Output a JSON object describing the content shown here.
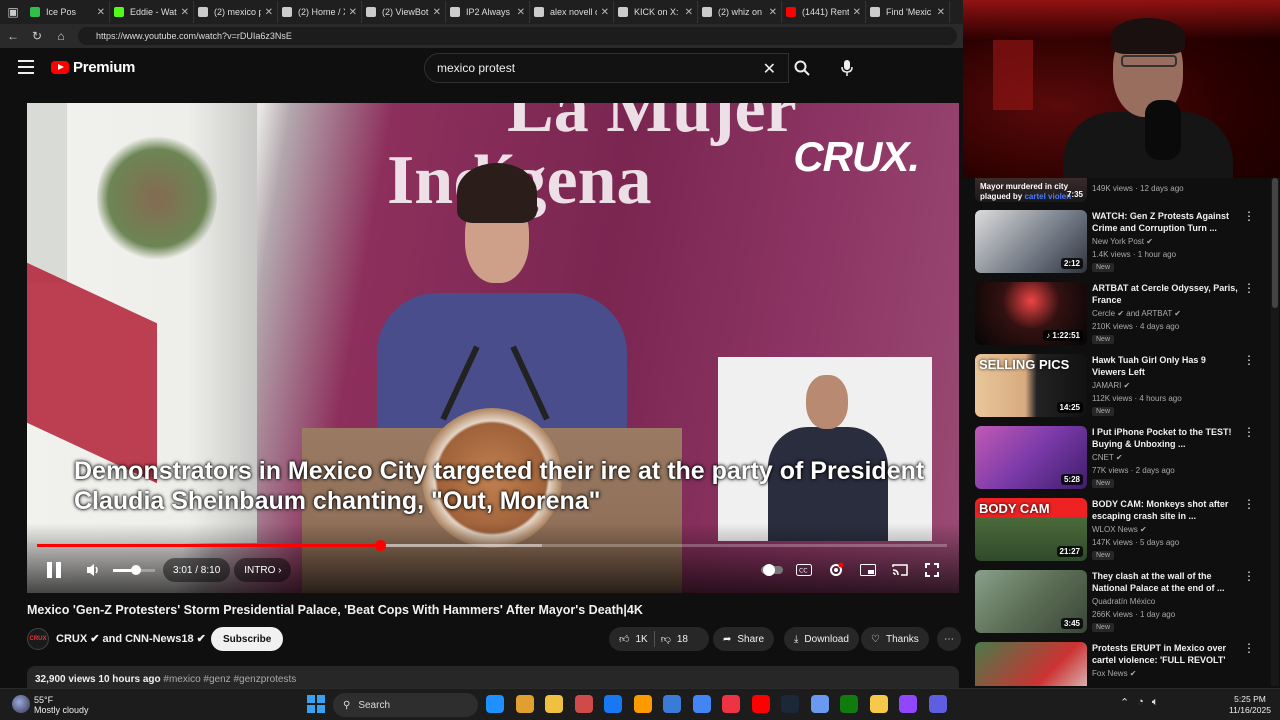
{
  "browser": {
    "tabs": [
      {
        "label": "Ice Pos",
        "color": "#2fbf4a"
      },
      {
        "label": "Eddie - Wat",
        "color": "#53fc18"
      },
      {
        "label": "(2) mexico p",
        "color": "#cccccc"
      },
      {
        "label": "(2) Home / X",
        "color": "#cccccc"
      },
      {
        "label": "(2) ViewBot",
        "color": "#cccccc"
      },
      {
        "label": "IP2 Always",
        "color": "#cccccc"
      },
      {
        "label": "alex novell c",
        "color": "#cccccc"
      },
      {
        "label": "KICK on X:",
        "color": "#cccccc"
      },
      {
        "label": "(2) whiz on",
        "color": "#cccccc"
      },
      {
        "label": "(1441) Rent",
        "color": "#ff0000"
      },
      {
        "label": "Find 'Mexic",
        "color": "#cccccc"
      }
    ],
    "url": "https://www.youtube.com/watch?v=rDUIa6z3NsE"
  },
  "header": {
    "brand": "Premium",
    "search_value": "mexico protest"
  },
  "player": {
    "bg_text_line1": "La Mujer",
    "bg_text_line2": "Indígena",
    "watermark": "CRUX.",
    "caption": "Demonstrators in Mexico City targeted their ire at the party of President Claudia Sheinbaum chanting, \"Out, Morena\"",
    "time": "3:01 / 8:10",
    "chapter": "INTRO",
    "progress_fraction": 0.377,
    "buffer_fraction": 0.555,
    "volume_fraction": 0.55
  },
  "video": {
    "title": "Mexico 'Gen-Z Protesters' Storm Presidential Palace, 'Beat Cops With Hammers' After Mayor's Death|4K",
    "channel": "CRUX ✔ and CNN-News18 ✔",
    "avatar_text": "CRUX",
    "subscribe": "Subscribe",
    "likes": "1K",
    "dislikes": "18",
    "share": "Share",
    "download": "Download",
    "thanks": "Thanks",
    "views_time": "32,900 views  10 hours ago",
    "tags": "#mexico #genz #genzprotests"
  },
  "sidebar": {
    "top_partial": {
      "title_a": "Mayor murdered in city",
      "title_b": "plagued by ",
      "title_hi": "cartel violen",
      "duration": "7:35",
      "stats": "149K views · 12 days ago"
    },
    "items": [
      {
        "title": "WATCH: Gen Z Protests Against Crime and Corruption Turn ...",
        "channel": "New York Post ✔",
        "stats": "1.4K views · 1 hour ago",
        "badge": "New",
        "duration": "2:12",
        "thumb_text": "",
        "bg": "linear-gradient(135deg,#dcdcdc,#6f7783 60%,#30343c)"
      },
      {
        "title": "ARTBAT at Cercle Odyssey, Paris, France",
        "channel": "Cercle ✔ and ARTBAT ✔",
        "stats": "210K views · 4 days ago",
        "badge": "New",
        "duration": "♪ 1:22:51",
        "thumb_text": "",
        "bg": "radial-gradient(circle at 50% 30%,#e44 0%,#311 40%,#050505 100%)"
      },
      {
        "title": "Hawk Tuah Girl Only Has 9 Viewers Left",
        "channel": "JAMARI ✔",
        "stats": "112K views · 4 hours ago",
        "badge": "New",
        "duration": "14:25",
        "thumb_text": "SELLING PICS",
        "bg": "linear-gradient(90deg,#e8c79a 0%,#d8aa80 45%,#222 55%,#111 100%)"
      },
      {
        "title": "I Put iPhone Pocket to the TEST! Buying & Unboxing ...",
        "channel": "CNET ✔",
        "stats": "77K views · 2 days ago",
        "badge": "New",
        "duration": "5:28",
        "thumb_text": "",
        "bg": "linear-gradient(135deg,#c25ab5,#7a3aa8 50%,#3e1d6a)"
      },
      {
        "title": "BODY CAM: Monkeys shot after escaping crash site in ...",
        "channel": "WLOX News ✔",
        "stats": "147K views · 5 days ago",
        "badge": "New",
        "duration": "21:27",
        "thumb_text": "BODY CAM",
        "bg": "linear-gradient(180deg,#e22 0%,#e22 30%,#4a6a3a 31%,#2f4a2a 100%)"
      },
      {
        "title": "They clash at the wall of the National Palace at the end of ...",
        "channel": "Quadratín México",
        "stats": "266K views · 1 day ago",
        "badge": "New",
        "duration": "3:45",
        "thumb_text": "",
        "bg": "linear-gradient(135deg,#8aa08a,#5c6f56 50%,#3a4538)"
      },
      {
        "title": "Protests ERUPT in Mexico over cartel violence: 'FULL REVOLT'",
        "channel": "Fox News ✔",
        "stats": "",
        "badge": "",
        "duration": "",
        "thumb_text": "",
        "bg": "linear-gradient(135deg,#4a7a4a,#c33 60%,#ddd)"
      }
    ]
  },
  "taskbar": {
    "temp": "55°F",
    "weather": "Mostly cloudy",
    "search": "Search",
    "time": "5:25 PM",
    "date": "11/16/2025",
    "apps": [
      "#1e90ff",
      "#e0a030",
      "#f0c040",
      "#d04a4a",
      "#1877f2",
      "#ff9900",
      "#3a7bd5",
      "#4285f4",
      "#e34",
      "#ff0000",
      "#1b2838",
      "#6a9af0",
      "#107c10",
      "#f7c948",
      "#9146ff",
      "#5e5ee0"
    ]
  }
}
